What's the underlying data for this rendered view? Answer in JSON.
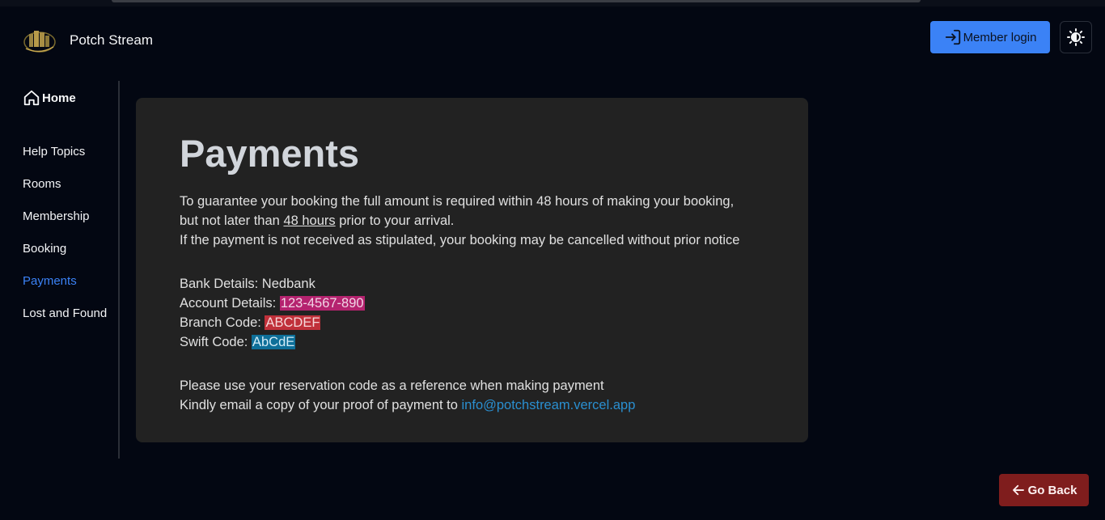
{
  "header": {
    "brand_name": "Potch Stream",
    "member_login_label": "Member login",
    "logo_icon": "building-logo-icon",
    "theme_toggle_icon": "theme-toggle-icon"
  },
  "sidebar": {
    "home_label": "Home",
    "items": [
      {
        "label": "Help Topics"
      },
      {
        "label": "Rooms"
      },
      {
        "label": "Membership"
      },
      {
        "label": "Booking"
      },
      {
        "label": "Payments"
      },
      {
        "label": "Lost and Found"
      }
    ],
    "active_index": 4
  },
  "content": {
    "title": "Payments",
    "p1_a": "To guarantee your booking the full amount is required within 48 hours of making your booking,",
    "p1_b_pre": "but not later than ",
    "p1_b_link": "48 hours",
    "p1_b_post": " prior to your arrival.",
    "p1_c": "If the payment is not received as stipulated, your booking may be cancelled without prior notice",
    "bank_label": "Bank Details: ",
    "bank_value": "Nedbank",
    "account_label": "Account Details: ",
    "account_value": "123-4567-890",
    "branch_label": "Branch Code: ",
    "branch_value": "ABCDEF",
    "swift_label": "Swift Code: ",
    "swift_value": "AbCdE",
    "ref_text": "Please use your reservation code as a reference when making payment",
    "email_pre": "Kindly email a copy of your proof of payment to ",
    "email": "info@potchstream.vercel.app"
  },
  "footer": {
    "go_back_label": "Go Back"
  },
  "colors": {
    "accent": "#3b82f6",
    "account_highlight": "#b5236f",
    "branch_highlight": "#c0303a",
    "swift_highlight": "#0e6f99",
    "go_back": "#7f1d1d"
  }
}
